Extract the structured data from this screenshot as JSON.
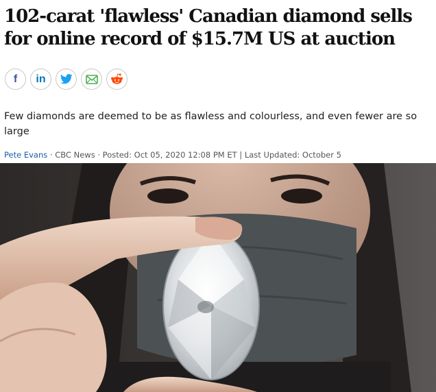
{
  "article": {
    "headline": "102-carat 'flawless' Canadian diamond sells for online record of $15.7M US at auction",
    "deck": "Few diamonds are deemed to be as flawless and colourless, and even fewer are so large",
    "byline": {
      "author": "Pete Evans",
      "sep1": " · ",
      "source": "CBC News",
      "sep2": " · ",
      "posted": "Posted: Oct 05, 2020 12:08 PM ET",
      "sep3": " | ",
      "updated": "Last Updated: October 5"
    }
  },
  "share": {
    "facebook": {
      "icon": "facebook-icon",
      "text": "f",
      "color": "#3b5998"
    },
    "linkedin": {
      "icon": "linkedin-icon",
      "text": "in",
      "color": "#0077b5"
    },
    "twitter": {
      "icon": "twitter-icon",
      "color": "#1da1f2"
    },
    "email": {
      "icon": "email-icon",
      "color": "#4caf50"
    },
    "reddit": {
      "icon": "reddit-icon",
      "color": "#ff4500"
    }
  },
  "colors": {
    "link": "#1a5ea8",
    "headline": "#111111",
    "meta": "#555555"
  }
}
